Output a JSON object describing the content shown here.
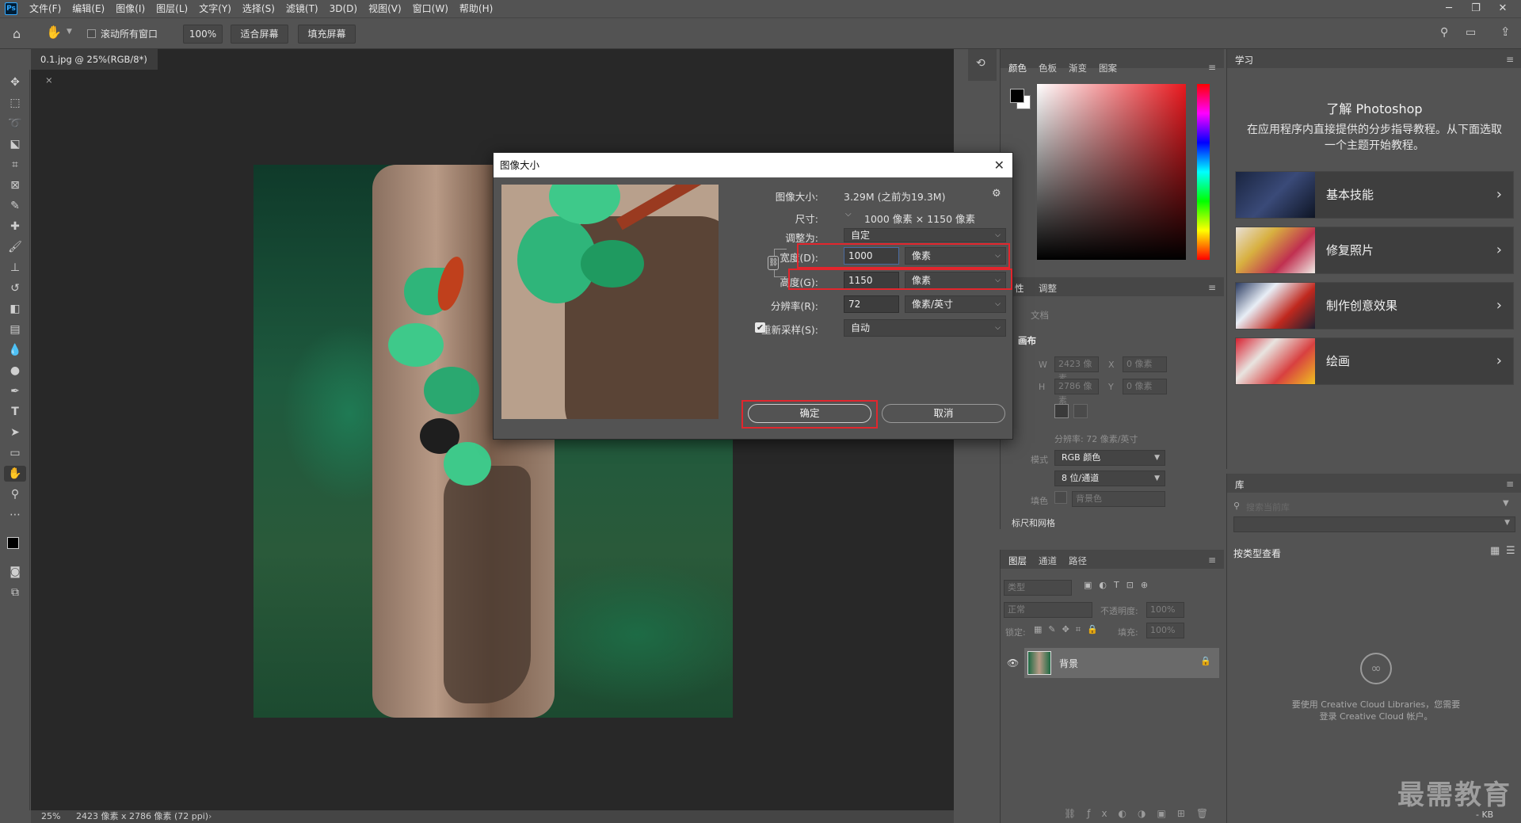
{
  "menubar": {
    "app_icon": "Ps",
    "items": [
      "文件(F)",
      "编辑(E)",
      "图像(I)",
      "图层(L)",
      "文字(Y)",
      "选择(S)",
      "滤镜(T)",
      "3D(D)",
      "视图(V)",
      "窗口(W)",
      "帮助(H)"
    ]
  },
  "options": {
    "scroll_all_windows": "滚动所有窗口",
    "zoom": "100%",
    "fit_screen": "适合屏幕",
    "fill_screen": "填充屏幕"
  },
  "document": {
    "tab_title": "0.1.jpg @ 25%(RGB/8*)",
    "status_zoom": "25%",
    "status_info": "2423 像素 x 2786 像素 (72 ppi)"
  },
  "dialog": {
    "title": "图像大小",
    "size_label": "图像大小:",
    "size_value": "3.29M (之前为19.3M)",
    "dimensions_label": "尺寸:",
    "dimensions_value": "1000 像素  ×  1150 像素",
    "fit_label": "调整为:",
    "fit_value": "自定",
    "width_label": "宽度(D):",
    "width_value": "1000",
    "width_unit": "像素",
    "height_label": "高度(G):",
    "height_value": "1150",
    "height_unit": "像素",
    "resolution_label": "分辨率(R):",
    "resolution_value": "72",
    "resolution_unit": "像素/英寸",
    "resample_label": "重新采样(S):",
    "resample_value": "自动",
    "ok": "确定",
    "cancel": "取消"
  },
  "color_panel": {
    "tabs": [
      "颜色",
      "色板",
      "渐变",
      "图案"
    ]
  },
  "properties_panel": {
    "tabs": [
      "性",
      "调整"
    ],
    "doc_label": "文档",
    "canvas_label": "画布",
    "w_label": "W",
    "w_value": "2423 像素",
    "x_label": "X",
    "x_value": "0 像素",
    "h_label": "H",
    "h_value": "2786 像素",
    "y_label": "Y",
    "y_value": "0 像素",
    "resolution_text": "分辨率: 72 像素/英寸",
    "mode_label": "模式",
    "mode_value": "RGB 颜色",
    "depth_value": "8 位/通道",
    "fill_label": "填色",
    "fill_value": "背景色",
    "section_next": "标尺和网格"
  },
  "layers_panel": {
    "tabs": [
      "图层",
      "通道",
      "路径"
    ],
    "filter_placeholder": "类型",
    "blend_mode": "正常",
    "opacity_label": "不透明度:",
    "opacity_value": "100%",
    "lock_label": "锁定:",
    "fill_label": "填充:",
    "fill_value": "100%",
    "layer_name": "背景"
  },
  "learn_panel": {
    "tab": "学习",
    "title": "了解 Photoshop",
    "description": "在应用程序内直接提供的分步指导教程。从下面选取一个主题开始教程。",
    "cards": [
      {
        "label": "基本技能"
      },
      {
        "label": "修复照片"
      },
      {
        "label": "制作创意效果"
      },
      {
        "label": "绘画"
      }
    ]
  },
  "library_panel": {
    "tab": "库",
    "search_placeholder": "搜索当前库",
    "view_by": "按类型查看",
    "cc_message": "要使用 Creative Cloud Libraries，您需要登录 Creative Cloud 帐户。",
    "size_text": "- KB"
  },
  "watermark": "最需教育"
}
